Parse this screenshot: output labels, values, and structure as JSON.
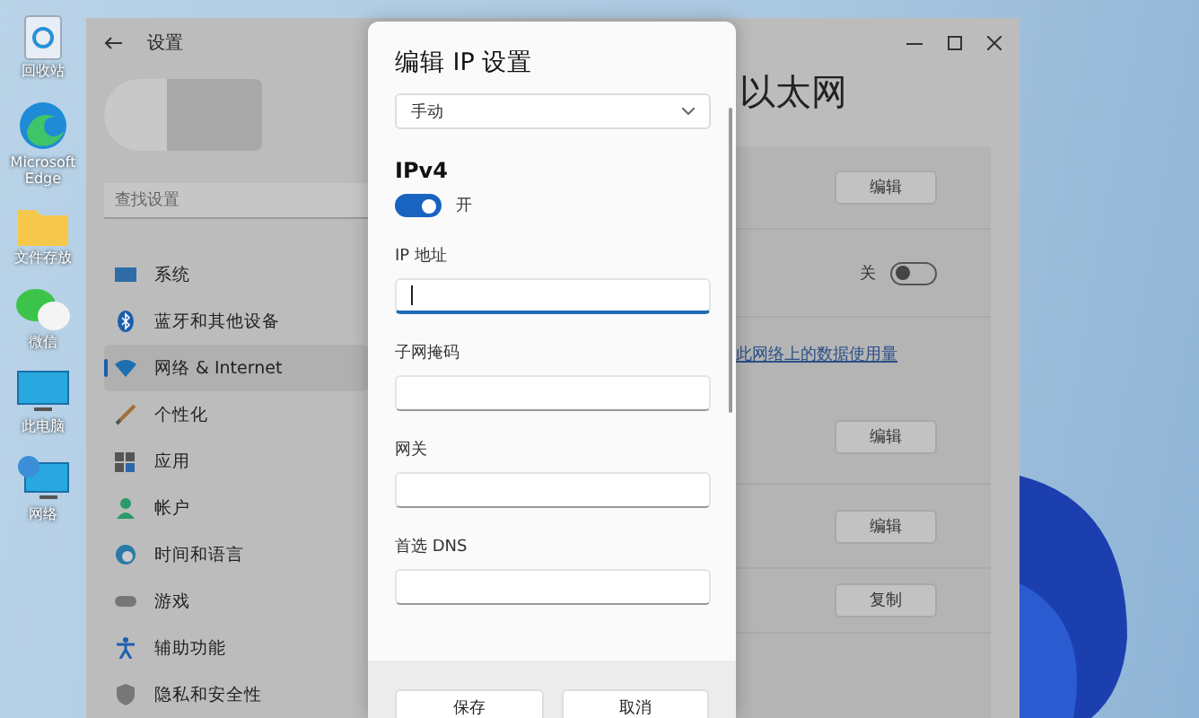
{
  "desktop_icons": [
    {
      "label": "回收站",
      "kind": "bin"
    },
    {
      "label": "Microsoft Edge",
      "kind": "edge"
    },
    {
      "label": "文件存放",
      "kind": "folder"
    },
    {
      "label": "微信",
      "kind": "chat"
    },
    {
      "label": "此电脑",
      "kind": "pc"
    },
    {
      "label": "网络",
      "kind": "network"
    }
  ],
  "window": {
    "title": "设置",
    "search": {
      "placeholder": "查找设置"
    }
  },
  "sidebar": {
    "items": [
      {
        "label": "系统",
        "selected": false,
        "kind": "system"
      },
      {
        "label": "蓝牙和其他设备",
        "selected": false,
        "kind": "bluetooth"
      },
      {
        "label": "网络 & Internet",
        "selected": true,
        "kind": "wifi"
      },
      {
        "label": "个性化",
        "selected": false,
        "kind": "brush"
      },
      {
        "label": "应用",
        "selected": false,
        "kind": "apps"
      },
      {
        "label": "帐户",
        "selected": false,
        "kind": "person"
      },
      {
        "label": "时间和语言",
        "selected": false,
        "kind": "globe"
      },
      {
        "label": "游戏",
        "selected": false,
        "kind": "game"
      },
      {
        "label": "辅助功能",
        "selected": false,
        "kind": "access"
      },
      {
        "label": "隐私和安全性",
        "selected": false,
        "kind": "shield"
      }
    ]
  },
  "page": {
    "title": "以太网",
    "rows": [
      {
        "kind": "button",
        "label": "编辑"
      },
      {
        "kind": "toggle",
        "label": "关",
        "on": false
      },
      {
        "kind": "link",
        "label": "此网络上的数据使用量"
      },
      {
        "kind": "button",
        "label": "编辑"
      },
      {
        "kind": "button",
        "label": "编辑"
      },
      {
        "kind": "button",
        "label": "复制"
      }
    ]
  },
  "dialog": {
    "title": "编辑 IP 设置",
    "mode": "手动",
    "section": "IPv4",
    "toggle": {
      "on": true,
      "label": "开"
    },
    "fields": [
      {
        "label": "IP 地址",
        "focused": true
      },
      {
        "label": "子网掩码",
        "focused": false
      },
      {
        "label": "网关",
        "focused": false
      },
      {
        "label": "首选 DNS",
        "focused": false
      }
    ],
    "buttons": [
      "保存",
      "取消"
    ]
  }
}
